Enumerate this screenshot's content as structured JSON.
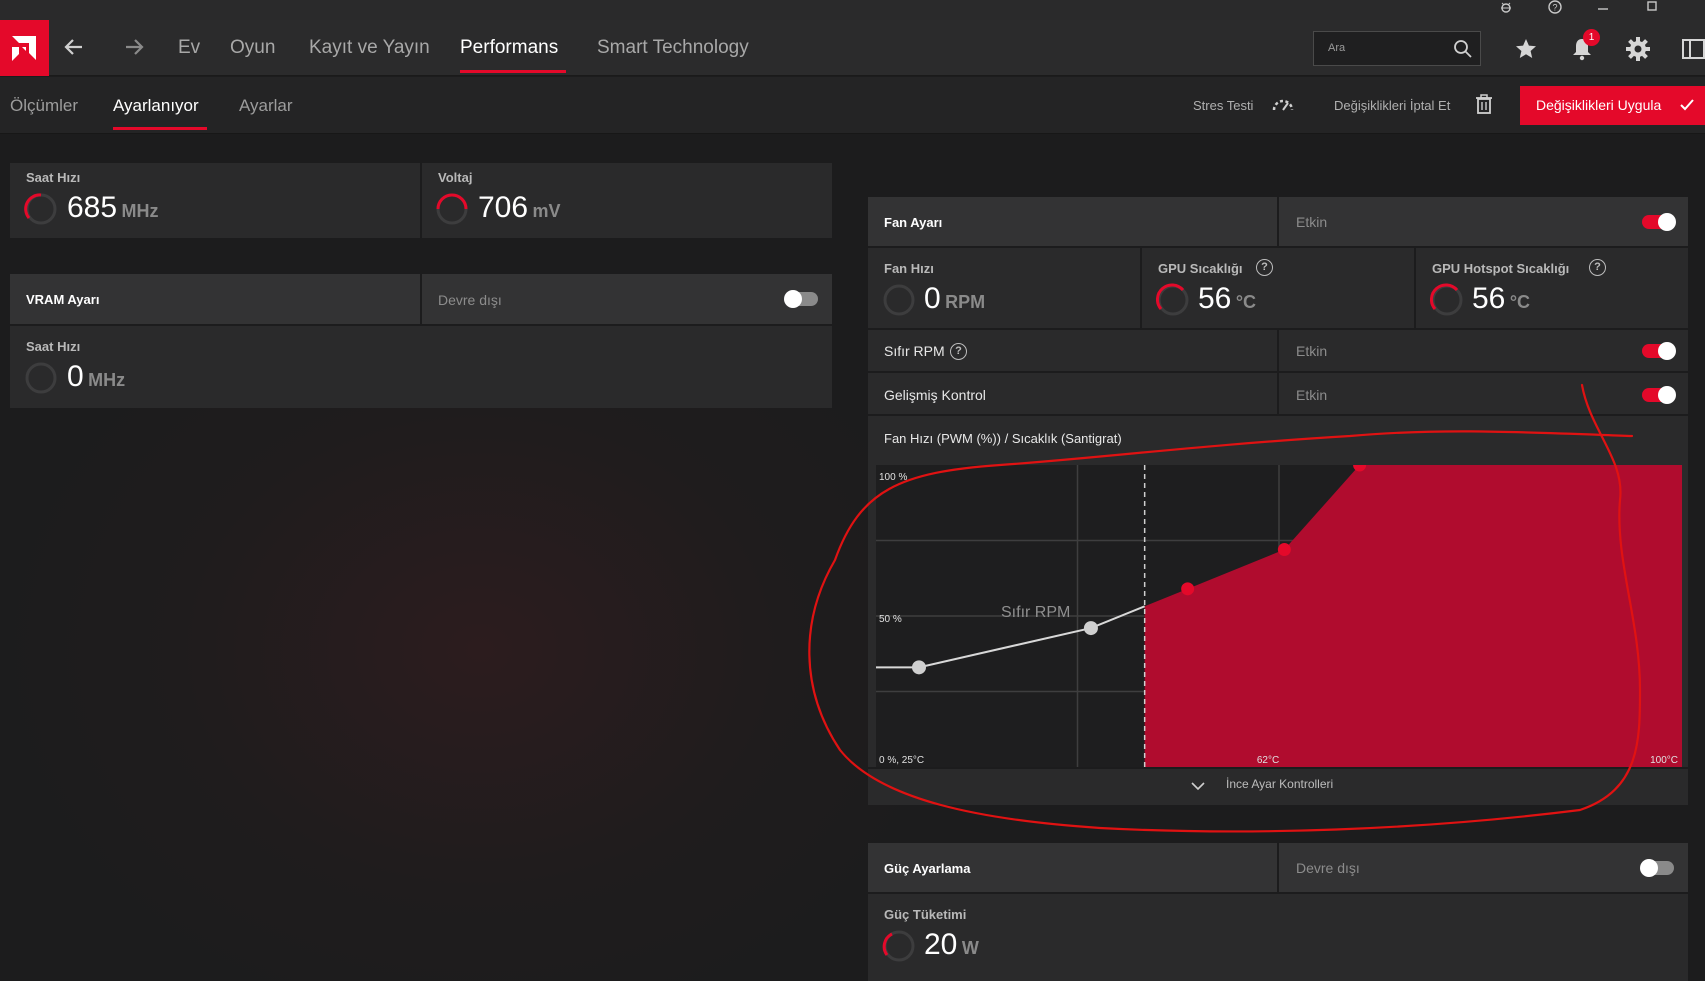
{
  "window": {
    "controls": [
      "bug-icon",
      "help-icon",
      "minimize-icon",
      "maximize-icon"
    ]
  },
  "nav": {
    "tabs": [
      {
        "label": "Ev"
      },
      {
        "label": "Oyun"
      },
      {
        "label": "Kayıt ve Yayın"
      },
      {
        "label": "Performans"
      },
      {
        "label": "Smart Technology"
      }
    ],
    "active_tab": "Performans",
    "search_placeholder": "Ara",
    "notification_count": "1"
  },
  "subnav": {
    "tabs": [
      {
        "label": "Ölçümler"
      },
      {
        "label": "Ayarlanıyor"
      },
      {
        "label": "Ayarlar"
      }
    ],
    "active_tab": "Ayarlanıyor",
    "stress_test_label": "Stres Testi",
    "discard_label": "Değişiklikleri İptal Et",
    "apply_label": "Değişiklikleri Uygula"
  },
  "gpu_metrics": {
    "clock": {
      "label": "Saat Hızı",
      "value": "685",
      "unit": "MHz"
    },
    "voltage": {
      "label": "Voltaj",
      "value": "706",
      "unit": "mV"
    }
  },
  "vram": {
    "title": "VRAM Ayarı",
    "status": "Devre dışı",
    "enabled": false,
    "clock": {
      "label": "Saat Hızı",
      "value": "0",
      "unit": "MHz"
    }
  },
  "fan": {
    "title": "Fan Ayarı",
    "status": "Etkin",
    "enabled": true,
    "fan_speed": {
      "label": "Fan Hızı",
      "value": "0",
      "unit": "RPM"
    },
    "gpu_temp": {
      "label": "GPU Sıcaklığı",
      "value": "56",
      "unit": "°C"
    },
    "hotspot_temp": {
      "label": "GPU Hotspot Sıcaklığı",
      "value": "56",
      "unit": "°C"
    },
    "zero_rpm": {
      "label": "Sıfır RPM",
      "status": "Etkin",
      "enabled": true
    },
    "advanced": {
      "label": "Gelişmiş Kontrol",
      "status": "Etkin",
      "enabled": true
    },
    "curve_title": "Fan Hızı (PWM (%)) / Sıcaklık (Santigrat)",
    "fine_tune_label": "İnce Ayar Kontrolleri"
  },
  "power": {
    "title": "Güç Ayarlama",
    "status": "Devre dışı",
    "enabled": false,
    "consumption": {
      "label": "Güç Tüketimi",
      "value": "20",
      "unit": "W"
    }
  },
  "colors": {
    "accent": "#e4092a",
    "curve_fill": "#b00c2e",
    "bg": "#1c1c1d"
  },
  "chart_data": {
    "type": "line",
    "x_range": [
      25,
      100
    ],
    "y_range": [
      0,
      100
    ],
    "tick_labels": {
      "y_top": "100 %",
      "y_mid": "50 %",
      "origin": "0 %, 25°C",
      "x_mid": "62°C",
      "x_end": "100°C"
    },
    "zero_rpm_label": "Sıfır RPM",
    "zero_rpm_threshold": 50,
    "points": [
      {
        "x": 29,
        "y": 33,
        "active": false
      },
      {
        "x": 45,
        "y": 46,
        "active": false
      },
      {
        "x": 54,
        "y": 59,
        "active": true
      },
      {
        "x": 63,
        "y": 72,
        "active": true
      },
      {
        "x": 70,
        "y": 100,
        "active": true
      }
    ]
  }
}
